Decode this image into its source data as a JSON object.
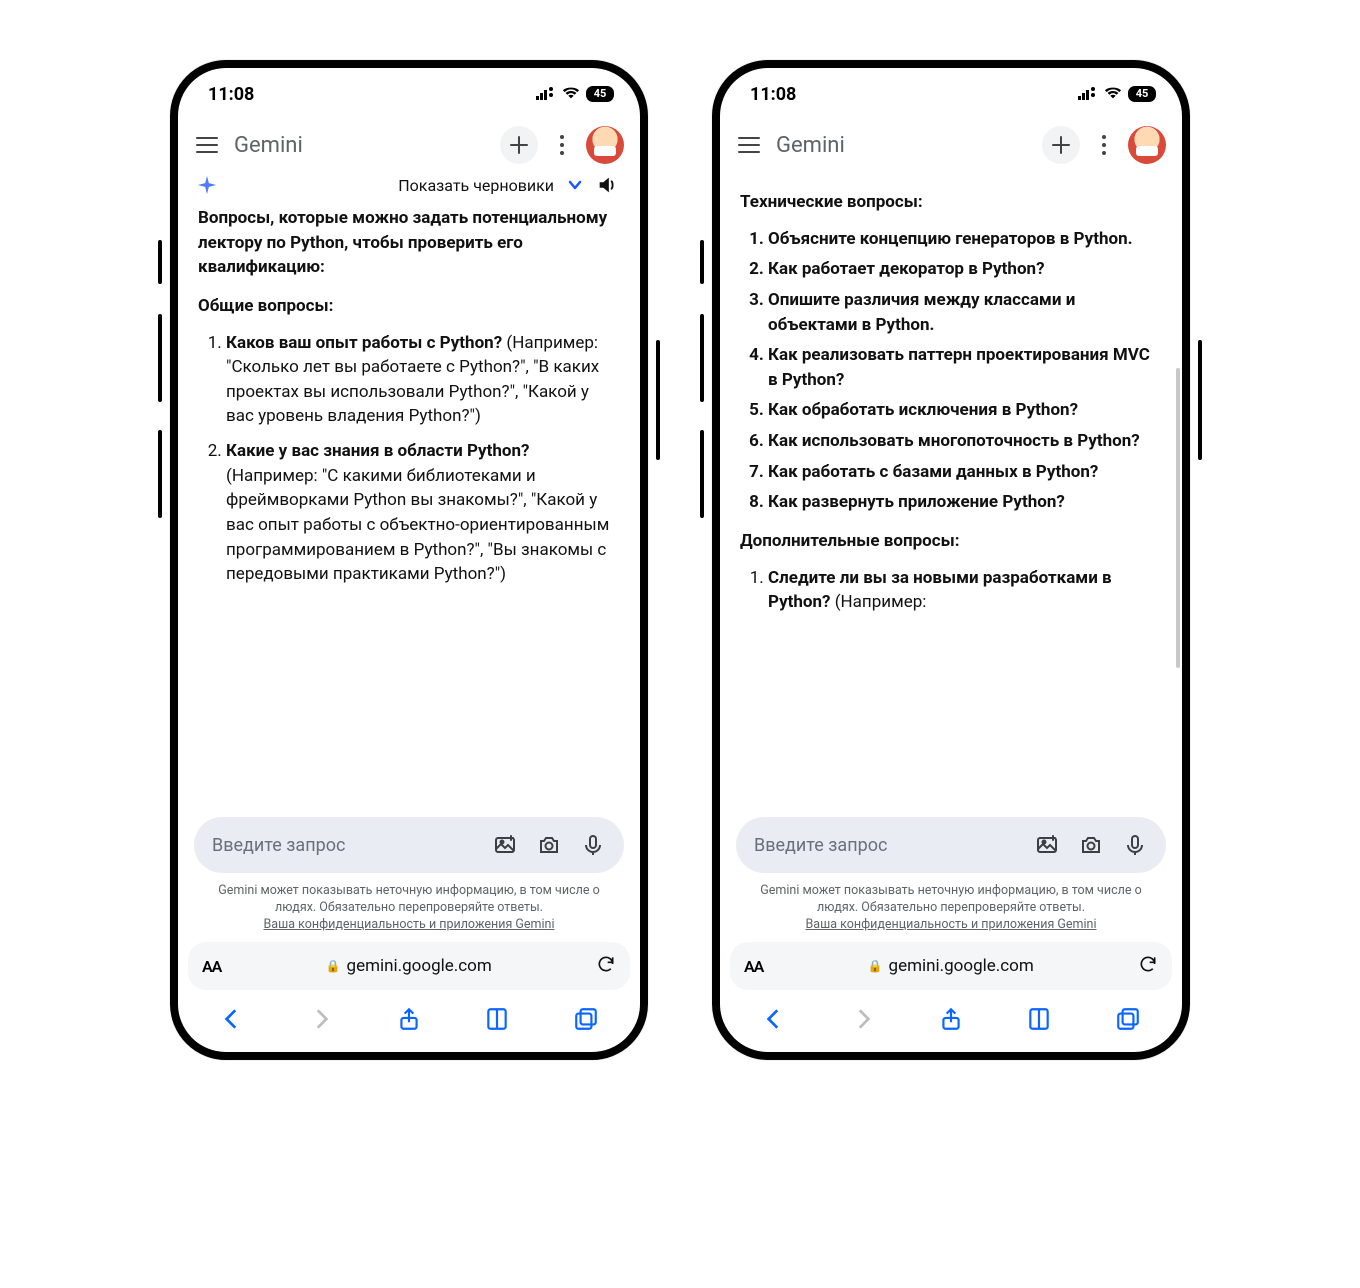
{
  "status": {
    "time": "11:08",
    "battery": "45"
  },
  "appbar": {
    "title": "Gemini"
  },
  "drafts": {
    "label": "Показать черновики"
  },
  "left_content": {
    "intro": "Вопросы, которые можно задать потенциальному лектору по Python, чтобы проверить его квалификацию:",
    "general_title": "Общие вопросы:",
    "general": [
      {
        "head": "Каков ваш опыт работы с Python?",
        "sub": "(Например: \"Сколько лет вы работаете с Python?\", \"В каких проектах вы использовали Python?\", \"Какой у вас уровень владения Python?\")"
      },
      {
        "head": "Какие у вас знания в области Python?",
        "sub": "(Например: \"С какими библиотеками и фреймворками Python вы знакомы?\", \"Какой у вас опыт работы с объектно-ориентированным программированием в Python?\", \"Вы знакомы с передовыми практиками Python?\")"
      }
    ]
  },
  "right_content": {
    "tech_title": "Технические вопросы:",
    "tech": [
      "Объясните концепцию генераторов в Python.",
      "Как работает декоратор в Python?",
      "Опишите различия между классами и объектами в Python.",
      "Как реализовать паттерн проектирования MVC в Python?",
      "Как обработать исключения в Python?",
      "Как использовать многопоточность в Python?",
      "Как работать с базами данных в Python?",
      "Как развернуть приложение Python?"
    ],
    "extra_title": "Дополнительные вопросы:",
    "extra": [
      {
        "head": "Следите ли вы за новыми разработками в Python?",
        "sub": " (Например:"
      }
    ]
  },
  "input": {
    "placeholder": "Введите запрос"
  },
  "notice": {
    "line": "Gemini может показывать неточную информацию, в том числе о людях. Обязательно перепроверяйте ответы.",
    "link": "Ваша конфиденциальность и приложения Gemini"
  },
  "addr": {
    "aA": "AA",
    "host": "gemini.google.com",
    "lock": "🔒"
  }
}
